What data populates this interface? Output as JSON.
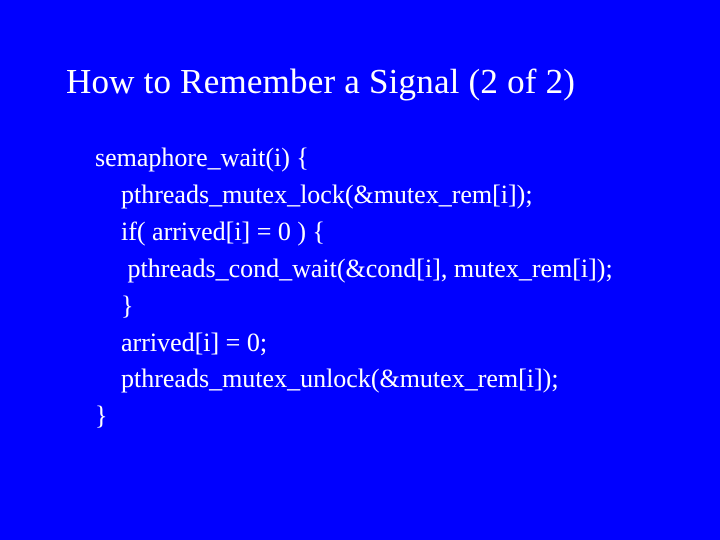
{
  "title": "How to Remember a Signal (2 of 2)",
  "body": [
    "semaphore_wait(i) {",
    "    pthreads_mutex_lock(&mutex_rem[i]);",
    "    if( arrived[i] = 0 ) {",
    "     pthreads_cond_wait(&cond[i], mutex_rem[i]);",
    "    }",
    "    arrived[i] = 0;",
    "    pthreads_mutex_unlock(&mutex_rem[i]);",
    "}"
  ]
}
